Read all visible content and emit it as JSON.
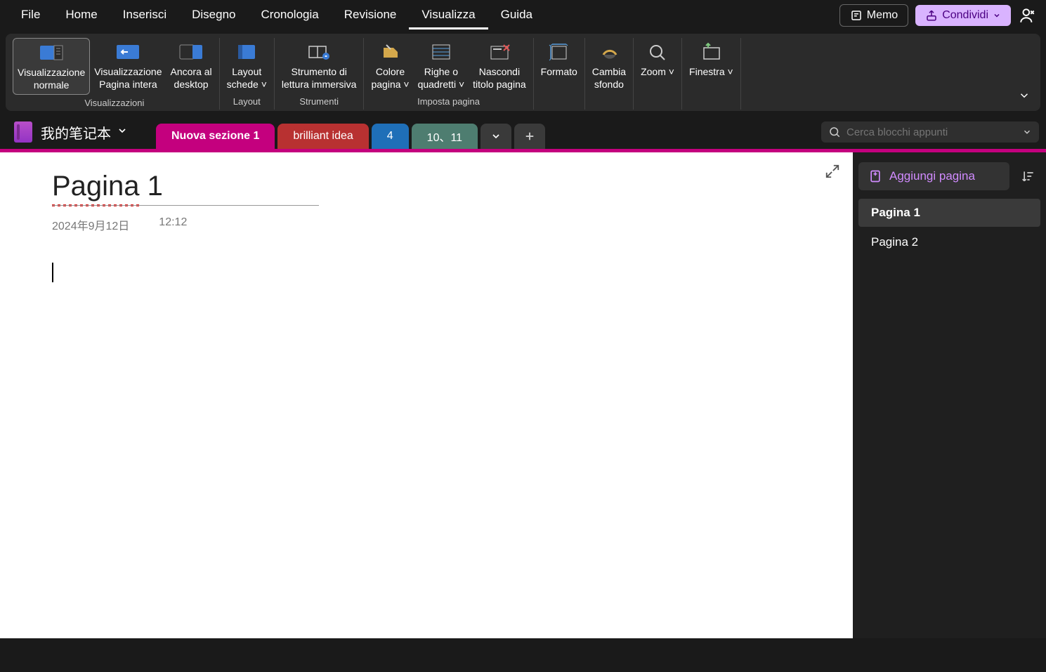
{
  "menu": {
    "items": [
      "File",
      "Home",
      "Inserisci",
      "Disegno",
      "Cronologia",
      "Revisione",
      "Visualizza",
      "Guida"
    ],
    "active_index": 6
  },
  "topbar": {
    "memo_label": "Memo",
    "share_label": "Condividi"
  },
  "ribbon": {
    "groups": [
      {
        "title": "Visualizzazioni",
        "buttons": [
          {
            "label": "Visualizzazione\nnormale",
            "active": true,
            "icon": "view-normal-icon"
          },
          {
            "label": "Visualizzazione\nPagina intera",
            "icon": "view-fullpage-icon"
          },
          {
            "label": "Ancora al\ndesktop",
            "icon": "dock-desktop-icon"
          }
        ]
      },
      {
        "title": "Layout",
        "buttons": [
          {
            "label": "Layout\nschede",
            "dropdown": true,
            "icon": "tab-layout-icon"
          }
        ]
      },
      {
        "title": "Strumenti",
        "buttons": [
          {
            "label": "Strumento di\nlettura immersiva",
            "icon": "immersive-reader-icon"
          }
        ]
      },
      {
        "title": "Imposta pagina",
        "buttons": [
          {
            "label": "Colore\npagina",
            "dropdown": true,
            "icon": "page-color-icon"
          },
          {
            "label": "Righe o\nquadretti",
            "dropdown": true,
            "icon": "rule-lines-icon"
          },
          {
            "label": "Nascondi\ntitolo pagina",
            "icon": "hide-title-icon"
          }
        ]
      },
      {
        "title": "",
        "buttons": [
          {
            "label": "Formato",
            "icon": "paper-size-icon"
          }
        ]
      },
      {
        "title": "",
        "buttons": [
          {
            "label": "Cambia\nsfondo",
            "icon": "background-icon"
          }
        ]
      },
      {
        "title": "",
        "buttons": [
          {
            "label": "Zoom",
            "dropdown": true,
            "icon": "zoom-icon"
          }
        ]
      },
      {
        "title": "",
        "buttons": [
          {
            "label": "Finestra",
            "dropdown": true,
            "icon": "window-icon"
          }
        ]
      }
    ]
  },
  "notebook": {
    "name": "我的笔记本",
    "sections": [
      {
        "label": "Nuova sezione 1",
        "color": "magenta"
      },
      {
        "label": "brilliant idea",
        "color": "red"
      },
      {
        "label": "4",
        "color": "blue"
      },
      {
        "label": "10、11",
        "color": "teal"
      }
    ],
    "search_placeholder": "Cerca blocchi appunti"
  },
  "page": {
    "title": "Pagina 1",
    "date": "2024年9月12日",
    "time": "12:12"
  },
  "pagelist": {
    "add_label": "Aggiungi pagina",
    "pages": [
      "Pagina 1",
      "Pagina 2"
    ],
    "active_index": 0
  }
}
